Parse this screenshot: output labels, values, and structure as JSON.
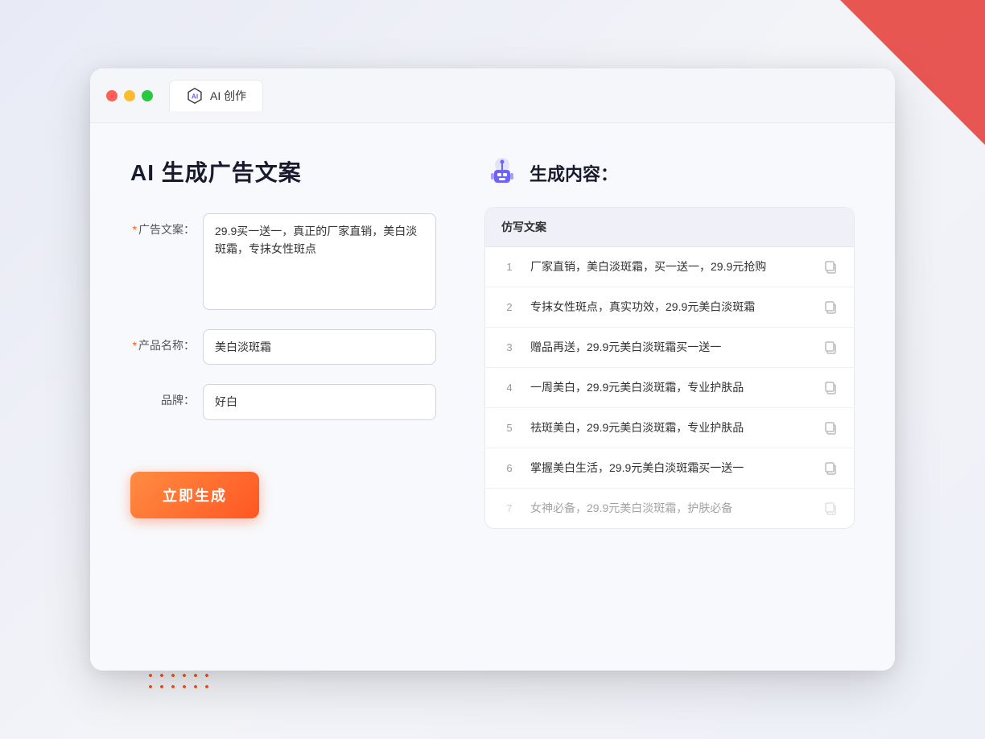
{
  "window": {
    "tab_label": "AI 创作"
  },
  "left_panel": {
    "title": "AI 生成广告文案",
    "fields": [
      {
        "id": "ad_copy",
        "label": "广告文案：",
        "required": true,
        "type": "textarea",
        "value": "29.9买一送一，真正的厂家直销，美白淡斑霜，专抹女性斑点"
      },
      {
        "id": "product_name",
        "label": "产品名称：",
        "required": true,
        "type": "input",
        "value": "美白淡斑霜"
      },
      {
        "id": "brand",
        "label": "品牌：",
        "required": false,
        "type": "input",
        "value": "好白"
      }
    ],
    "generate_button": "立即生成"
  },
  "right_panel": {
    "title": "生成内容：",
    "table_header": "仿写文案",
    "results": [
      {
        "num": "1",
        "text": "厂家直销，美白淡斑霜，买一送一，29.9元抢购",
        "faded": false
      },
      {
        "num": "2",
        "text": "专抹女性斑点，真实功效，29.9元美白淡斑霜",
        "faded": false
      },
      {
        "num": "3",
        "text": "赠品再送，29.9元美白淡斑霜买一送一",
        "faded": false
      },
      {
        "num": "4",
        "text": "一周美白，29.9元美白淡斑霜，专业护肤品",
        "faded": false
      },
      {
        "num": "5",
        "text": "祛斑美白，29.9元美白淡斑霜，专业护肤品",
        "faded": false
      },
      {
        "num": "6",
        "text": "掌握美白生活，29.9元美白淡斑霜买一送一",
        "faded": false
      },
      {
        "num": "7",
        "text": "女神必备，29.9元美白淡斑霜，护肤必备",
        "faded": true
      }
    ]
  },
  "colors": {
    "accent": "#ff5722",
    "purple": "#6c63ff"
  }
}
